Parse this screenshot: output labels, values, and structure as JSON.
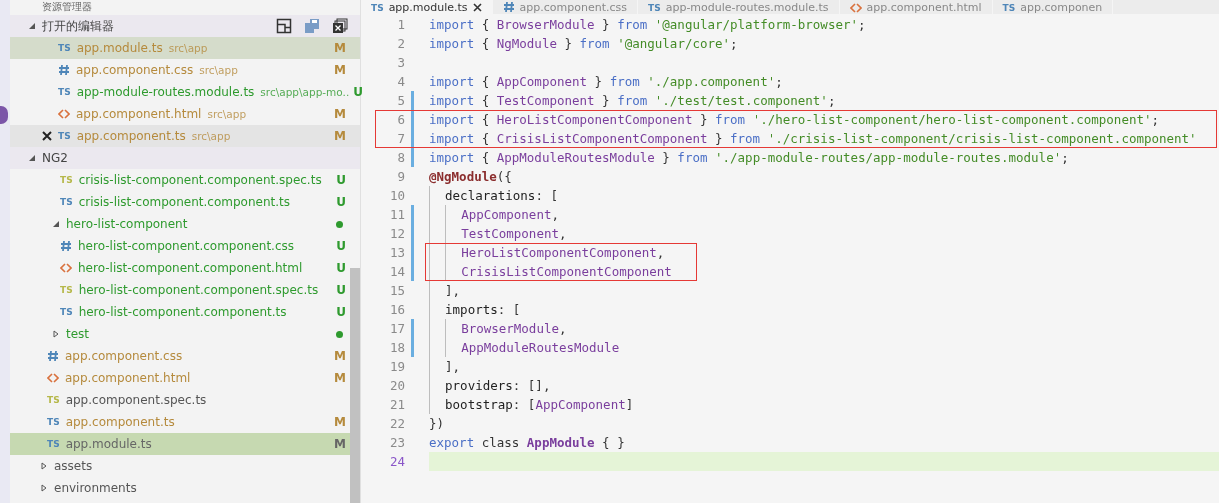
{
  "sidebar": {
    "title": "资源管理器",
    "open_editors": {
      "title": "打开的编辑器",
      "expanded": true,
      "items": [
        {
          "kind": "ts",
          "badge": "TS",
          "name": "app.module.ts",
          "path": "src\\app",
          "status": "M",
          "color": "#b58a3c",
          "selected": true,
          "hovered": false
        },
        {
          "kind": "css",
          "name": "app.component.css",
          "path": "src\\app",
          "status": "M",
          "color": "#b58a3c",
          "selected": false,
          "hovered": false
        },
        {
          "kind": "ts",
          "badge": "TS",
          "name": "app-module-routes.module.ts",
          "path": "src\\app\\app-mo..",
          "status": "U",
          "color": "#2e9a2e",
          "selected": false,
          "hovered": false
        },
        {
          "kind": "html",
          "name": "app.component.html",
          "path": "src\\app",
          "status": "M",
          "color": "#b58a3c",
          "selected": false,
          "hovered": false
        },
        {
          "kind": "ts",
          "badge": "TS",
          "name": "app.component.ts",
          "path": "src\\app",
          "status": "M",
          "color": "#b58a3c",
          "selected": false,
          "hovered": true
        }
      ]
    },
    "project": {
      "title": "NG2",
      "expanded": true,
      "tree": [
        {
          "children": [
            {
              "children": [
                {
                  "kind": "spec",
                  "badge": "TS",
                  "name": "crisis-list-component.component.spec.ts",
                  "status": "U",
                  "color": "#2e9a2e",
                  "selected": false
                },
                {
                  "kind": "ts",
                  "badge": "TS",
                  "name": "crisis-list-component.component.ts",
                  "status": "U",
                  "color": "#2e9a2e",
                  "selected": false
                }
              ]
            },
            {
              "kind": "folder",
              "name": "hero-list-component",
              "expanded": true,
              "changed": true,
              "color": "#2e9a2e",
              "selected": false,
              "children": [
                {
                  "kind": "css",
                  "name": "hero-list-component.component.css",
                  "status": "U",
                  "color": "#2e9a2e",
                  "selected": false
                },
                {
                  "kind": "html",
                  "name": "hero-list-component.component.html",
                  "status": "U",
                  "color": "#2e9a2e",
                  "selected": false
                },
                {
                  "kind": "spec",
                  "badge": "TS",
                  "name": "hero-list-component.component.spec.ts",
                  "status": "U",
                  "color": "#2e9a2e",
                  "selected": false
                },
                {
                  "kind": "ts",
                  "badge": "TS",
                  "name": "hero-list-component.component.ts",
                  "status": "U",
                  "color": "#2e9a2e",
                  "selected": false
                }
              ]
            },
            {
              "kind": "folder",
              "name": "test",
              "expanded": false,
              "changed": true,
              "color": "#2e9a2e",
              "selected": false
            },
            {
              "kind": "css",
              "name": "app.component.css",
              "status": "M",
              "color": "#b58a3c",
              "selected": false
            },
            {
              "kind": "html",
              "name": "app.component.html",
              "status": "M",
              "color": "#b58a3c",
              "selected": false
            },
            {
              "kind": "spec",
              "badge": "TS",
              "name": "app.component.spec.ts",
              "color": "#555555",
              "selected": false
            },
            {
              "kind": "ts",
              "badge": "TS",
              "name": "app.component.ts",
              "status": "M",
              "color": "#b58a3c",
              "selected": false
            },
            {
              "kind": "ts",
              "badge": "TS",
              "name": "app.module.ts",
              "status": "M",
              "color": "#666666",
              "selected": true
            }
          ]
        },
        {
          "kind": "folder",
          "name": "assets",
          "expanded": false,
          "changed": false,
          "color": "#555555",
          "selected": false
        },
        {
          "kind": "folder",
          "name": "environments",
          "expanded": false,
          "changed": false,
          "color": "#555555",
          "selected": false
        }
      ]
    }
  },
  "editor": {
    "tabs": [
      {
        "kind": "ts",
        "badge": "TS",
        "label": "app.module.ts",
        "selected": true
      },
      {
        "kind": "css",
        "label": "app.component.css",
        "selected": false
      },
      {
        "kind": "ts",
        "badge": "TS",
        "label": "app-module-routes.module.ts",
        "selected": false
      },
      {
        "kind": "html",
        "label": "app.component.html",
        "selected": false
      },
      {
        "kind": "ts",
        "badge": "TS",
        "label": "app.componen",
        "selected": false
      }
    ],
    "lines": [
      {
        "n": "1",
        "kind": "plain",
        "tokens": [
          {
            "kind": "keyword",
            "text": "import"
          },
          {
            "kind": "punct",
            "text": " { "
          },
          {
            "kind": "name",
            "text": "BrowserModule"
          },
          {
            "kind": "punct",
            "text": " } "
          },
          {
            "kind": "keyword",
            "text": "from "
          },
          {
            "kind": "string",
            "text": "'@angular/platform-browser'"
          },
          {
            "kind": "punct",
            "text": ";"
          }
        ]
      },
      {
        "n": "2",
        "kind": "plain",
        "tokens": [
          {
            "kind": "keyword",
            "text": "import"
          },
          {
            "kind": "punct",
            "text": " { "
          },
          {
            "kind": "name",
            "text": "NgModule"
          },
          {
            "kind": "punct",
            "text": " } "
          },
          {
            "kind": "keyword",
            "text": "from "
          },
          {
            "kind": "string",
            "text": "'@angular/core'"
          },
          {
            "kind": "punct",
            "text": ";"
          }
        ]
      },
      {
        "n": "3",
        "kind": "plain"
      },
      {
        "n": "4",
        "kind": "plain",
        "tokens": [
          {
            "kind": "keyword",
            "text": "import"
          },
          {
            "kind": "punct",
            "text": " { "
          },
          {
            "kind": "name",
            "text": "AppComponent"
          },
          {
            "kind": "punct",
            "text": " } "
          },
          {
            "kind": "keyword",
            "text": "from "
          },
          {
            "kind": "string",
            "text": "'./app.component'"
          },
          {
            "kind": "punct",
            "text": ";"
          }
        ]
      },
      {
        "n": "5",
        "kind": "plain",
        "changed": true,
        "tokens": [
          {
            "kind": "keyword",
            "text": "import"
          },
          {
            "kind": "punct",
            "text": " { "
          },
          {
            "kind": "name",
            "text": "TestComponent"
          },
          {
            "kind": "punct",
            "text": " } "
          },
          {
            "kind": "keyword",
            "text": "from "
          },
          {
            "kind": "string",
            "text": "'./test/test.component'"
          },
          {
            "kind": "punct",
            "text": ";"
          }
        ]
      },
      {
        "n": "6",
        "kind": "wide-box",
        "changed": true,
        "tokens": [
          {
            "kind": "keyword",
            "text": "import"
          },
          {
            "kind": "punct",
            "text": " { "
          },
          {
            "kind": "name",
            "text": "HeroListComponentComponent"
          },
          {
            "kind": "punct",
            "text": " } "
          },
          {
            "kind": "keyword",
            "text": "from "
          },
          {
            "kind": "string",
            "text": "'./hero-list-component/hero-list-component.component'"
          },
          {
            "kind": "punct",
            "text": ";"
          }
        ]
      },
      {
        "n": "7",
        "kind": "wide-box",
        "changed": true,
        "tokens": [
          {
            "kind": "keyword",
            "text": "import"
          },
          {
            "kind": "punct",
            "text": " { "
          },
          {
            "kind": "name",
            "text": "CrisisListComponentComponent"
          },
          {
            "kind": "punct",
            "text": " } "
          },
          {
            "kind": "keyword",
            "text": "from "
          },
          {
            "kind": "string",
            "text": "'./crisis-list-component/crisis-list-component.component'"
          }
        ]
      },
      {
        "n": "8",
        "kind": "plain",
        "changed": true,
        "tokens": [
          {
            "kind": "keyword",
            "text": "import"
          },
          {
            "kind": "punct",
            "text": " { "
          },
          {
            "kind": "name",
            "text": "AppModuleRoutesModule"
          },
          {
            "kind": "punct",
            "text": " } "
          },
          {
            "kind": "keyword",
            "text": "from "
          },
          {
            "kind": "string",
            "text": "'./app-module-routes/app-module-routes.module'"
          },
          {
            "kind": "punct",
            "text": ";"
          }
        ]
      },
      {
        "n": "9",
        "kind": "plain",
        "tokens": [
          {
            "kind": "decorator",
            "text": "@NgModule"
          },
          {
            "kind": "punct",
            "text": "({"
          }
        ]
      },
      {
        "n": "10",
        "kind": "plain",
        "tokens": [
          {
            "kind": "property",
            "text": "  declarations"
          },
          {
            "kind": "punct",
            "text": ": ["
          }
        ]
      },
      {
        "n": "11",
        "kind": "plain",
        "changed": true,
        "tokens": [
          {
            "kind": "name",
            "text": "    AppComponent"
          },
          {
            "kind": "punct",
            "text": ","
          }
        ]
      },
      {
        "n": "12",
        "kind": "plain",
        "changed": true,
        "tokens": [
          {
            "kind": "name",
            "text": "    TestComponent"
          },
          {
            "kind": "punct",
            "text": ","
          }
        ]
      },
      {
        "n": "13",
        "kind": "narrow-box",
        "changed": true,
        "tokens": [
          {
            "kind": "name",
            "text": "    HeroListComponentComponent"
          },
          {
            "kind": "punct",
            "text": ","
          }
        ]
      },
      {
        "n": "14",
        "kind": "narrow-box",
        "changed": true,
        "tokens": [
          {
            "kind": "name",
            "text": "    CrisisListComponentComponent"
          }
        ]
      },
      {
        "n": "15",
        "kind": "plain",
        "tokens": [
          {
            "kind": "punct",
            "text": "  ],"
          }
        ]
      },
      {
        "n": "16",
        "kind": "plain",
        "tokens": [
          {
            "kind": "property",
            "text": "  imports"
          },
          {
            "kind": "punct",
            "text": ": ["
          }
        ]
      },
      {
        "n": "17",
        "kind": "plain",
        "changed": true,
        "tokens": [
          {
            "kind": "name",
            "text": "    BrowserModule"
          },
          {
            "kind": "punct",
            "text": ","
          }
        ]
      },
      {
        "n": "18",
        "kind": "plain",
        "changed": true,
        "tokens": [
          {
            "kind": "name",
            "text": "    AppModuleRoutesModule"
          }
        ]
      },
      {
        "n": "19",
        "kind": "plain",
        "tokens": [
          {
            "kind": "punct",
            "text": "  ],"
          }
        ]
      },
      {
        "n": "20",
        "kind": "plain",
        "tokens": [
          {
            "kind": "property",
            "text": "  providers"
          },
          {
            "kind": "punct",
            "text": ": [],"
          }
        ]
      },
      {
        "n": "21",
        "kind": "plain",
        "tokens": [
          {
            "kind": "property",
            "text": "  bootstrap"
          },
          {
            "kind": "punct",
            "text": ": ["
          },
          {
            "kind": "name",
            "text": "AppComponent"
          },
          {
            "kind": "punct",
            "text": "]"
          }
        ]
      },
      {
        "n": "22",
        "kind": "plain",
        "tokens": [
          {
            "kind": "punct",
            "text": "})"
          }
        ]
      },
      {
        "n": "23",
        "kind": "plain",
        "tokens": [
          {
            "kind": "keyword",
            "text": "export"
          },
          {
            "kind": "punct",
            "text": " class "
          },
          {
            "kind": "classname",
            "text": "AppModule"
          },
          {
            "kind": "punct",
            "text": " { }"
          }
        ]
      },
      {
        "n": "24",
        "kind": "plain",
        "current": true
      }
    ]
  }
}
